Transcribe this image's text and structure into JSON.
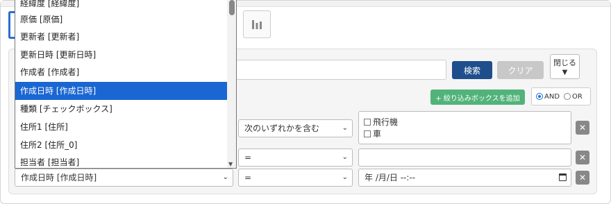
{
  "toolbar": {
    "chart_icon": "bar-chart-icon"
  },
  "search": {
    "search_label": "検索",
    "clear_label": "クリア",
    "close_label": "閉じる",
    "close_arrow": "▼",
    "add_filter_label": "+ 絞り込みボックスを追加",
    "and_label": "AND",
    "or_label": "OR",
    "logic_selected": "AND"
  },
  "filters": {
    "row1": {
      "field": "",
      "operator": "次のいずれかを含む",
      "options": [
        "飛行機",
        "車"
      ]
    },
    "row2": {
      "field": "",
      "operator": "=",
      "value": ""
    },
    "row3": {
      "field": "作成日時 [作成日時]",
      "operator": "=",
      "value": "年 /月/日 --:--"
    },
    "delete_label": "✕"
  },
  "dropdown": {
    "items": [
      "経緯度 [経緯度]",
      "原価 [原価]",
      "更新者 [更新者]",
      "更新日時 [更新日時]",
      "作成者 [作成者]",
      "作成日時 [作成日時]",
      "種類 [チェックボックス]",
      "住所1 [住所]",
      "住所2 [住所_0]",
      "担当者 [担当者]"
    ],
    "selected": "作成日時 [作成日時]"
  },
  "colors": {
    "accent_blue": "#1f4e8c",
    "selection": "#1a66d2",
    "add_green": "#52b37a"
  }
}
